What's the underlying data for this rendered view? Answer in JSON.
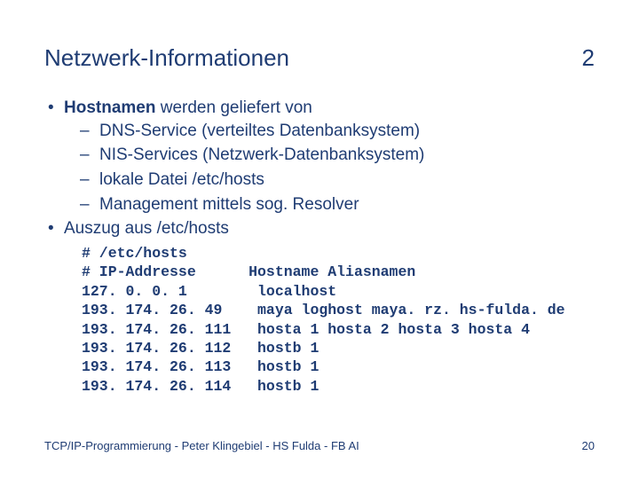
{
  "header": {
    "title": "Netzwerk-Informationen",
    "number": "2"
  },
  "bullets": {
    "b1_strong": "Hostnamen",
    "b1_rest": " werden geliefert von",
    "b1_sub1": "DNS-Service (verteiltes Datenbanksystem)",
    "b1_sub2": "NIS-Services (Netzwerk-Datenbanksystem)",
    "b1_sub3": "lokale Datei /etc/hosts",
    "b1_sub4": "Management mittels sog. Resolver",
    "b2": "Auszug aus /etc/hosts"
  },
  "code": "# /etc/hosts\n# IP-Addresse      Hostname Aliasnamen\n127. 0. 0. 1        localhost\n193. 174. 26. 49    maya loghost maya. rz. hs-fulda. de\n193. 174. 26. 111   hosta 1 hosta 2 hosta 3 hosta 4\n193. 174. 26. 112   hostb 1\n193. 174. 26. 113   hostb 1\n193. 174. 26. 114   hostb 1",
  "footer": {
    "text": "TCP/IP-Programmierung - Peter Klingebiel - HS Fulda - FB AI",
    "page": "20"
  }
}
